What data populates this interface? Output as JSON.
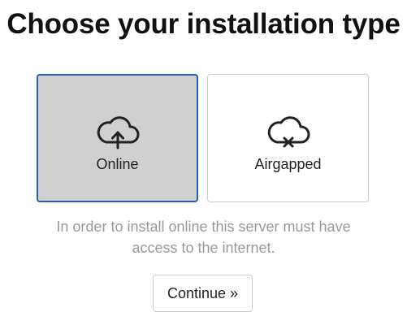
{
  "title": "Choose your installation type",
  "options": [
    {
      "label": "Online",
      "icon": "cloud-upload-icon",
      "selected": true
    },
    {
      "label": "Airgapped",
      "icon": "cloud-off-icon",
      "selected": false
    }
  ],
  "help_text": "In order to install online this server must have access to the internet.",
  "continue_label": "Continue »",
  "colors": {
    "selected_background": "#d0d0d0",
    "selected_border": "#1f5fb8",
    "help_text": "#999999"
  }
}
